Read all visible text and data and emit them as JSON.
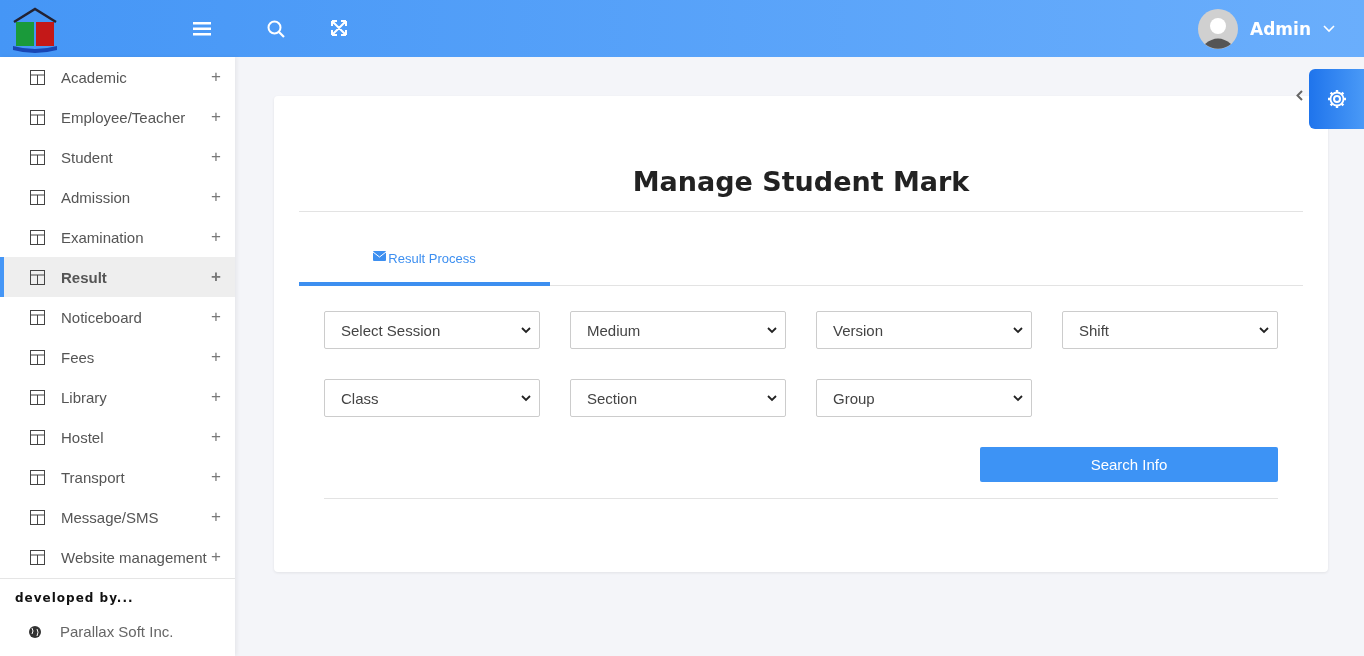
{
  "header": {
    "user_name": "Admin"
  },
  "sidebar": {
    "items": [
      {
        "label": "Academic",
        "selected": false
      },
      {
        "label": "Employee/Teacher",
        "selected": false
      },
      {
        "label": "Student",
        "selected": false
      },
      {
        "label": "Admission",
        "selected": false
      },
      {
        "label": "Examination",
        "selected": false
      },
      {
        "label": "Result",
        "selected": true
      },
      {
        "label": "Noticeboard",
        "selected": false
      },
      {
        "label": "Fees",
        "selected": false
      },
      {
        "label": "Library",
        "selected": false
      },
      {
        "label": "Hostel",
        "selected": false
      },
      {
        "label": "Transport",
        "selected": false
      },
      {
        "label": "Message/SMS",
        "selected": false
      },
      {
        "label": "Website management",
        "selected": false
      }
    ],
    "expand_sign": "+",
    "footer_heading": "developed by...",
    "developer": "Parallax Soft Inc."
  },
  "card": {
    "title": "Manage Student Mark",
    "tabs": [
      {
        "label": "Result Process",
        "selected": true
      }
    ],
    "filters": [
      [
        {
          "value": "Select Session"
        },
        {
          "value": "Medium"
        },
        {
          "value": "Version"
        },
        {
          "value": "Shift"
        }
      ],
      [
        {
          "value": "Class"
        },
        {
          "value": "Section"
        },
        {
          "value": "Group"
        }
      ]
    ],
    "button": "Search Info"
  }
}
